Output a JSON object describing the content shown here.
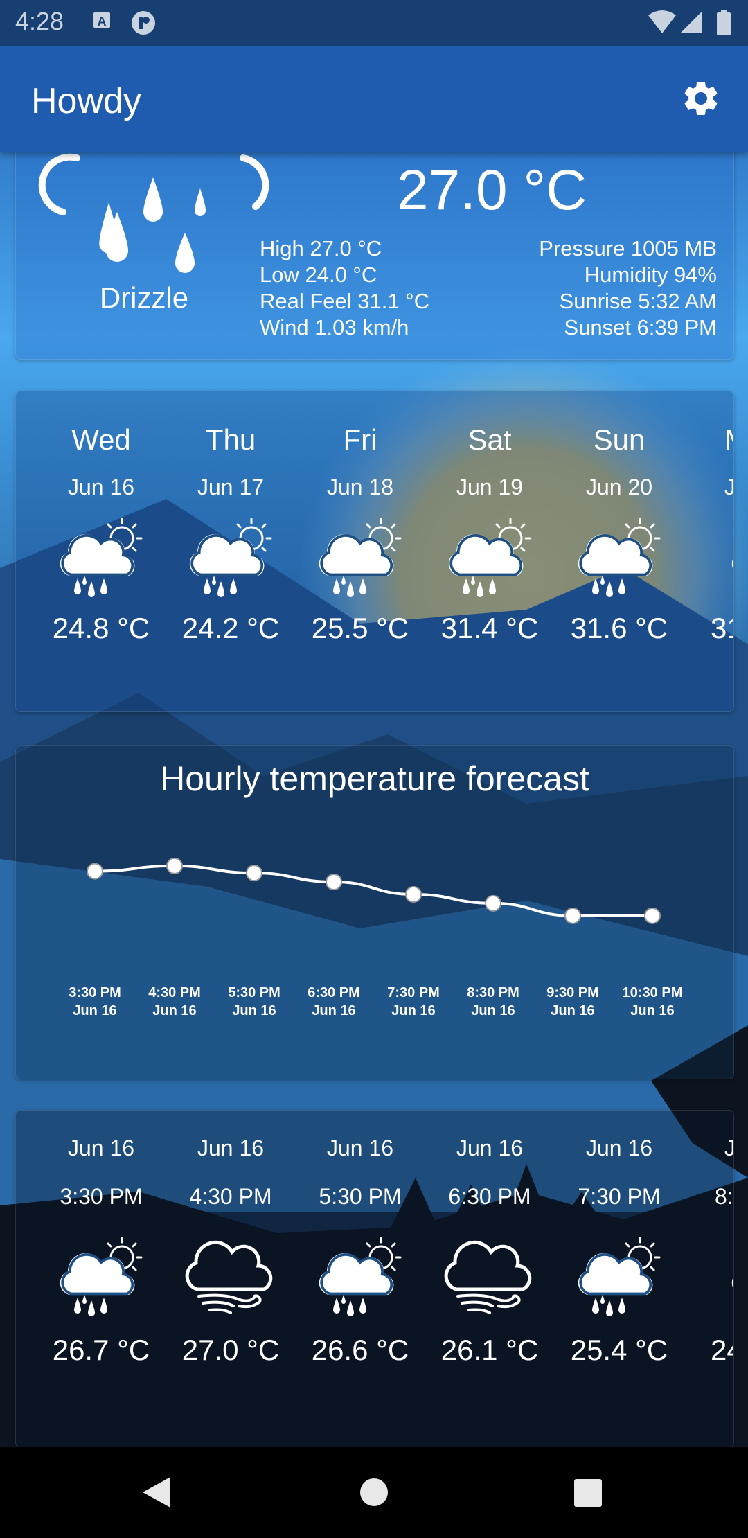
{
  "status_bar": {
    "time": "4:28"
  },
  "app_bar": {
    "title": "Howdy",
    "settings_icon": "gear-icon"
  },
  "current": {
    "condition": "Drizzle",
    "icon": "drizzle-icon",
    "temperature": "27.0 °C",
    "high": "High 27.0 °C",
    "low": "Low 24.0 °C",
    "real_feel": "Real Feel 31.1 °C",
    "wind": "Wind 1.03 km/h",
    "pressure": "Pressure 1005 MB",
    "humidity": "Humidity 94%",
    "sunrise": "Sunrise 5:32 AM",
    "sunset": "Sunset 6:39 PM"
  },
  "daily": [
    {
      "day": "Wed",
      "date": "Jun 16",
      "icon": "sun-rain-icon",
      "temp": "24.8 °C"
    },
    {
      "day": "Thu",
      "date": "Jun 17",
      "icon": "sun-rain-icon",
      "temp": "24.2 °C"
    },
    {
      "day": "Fri",
      "date": "Jun 18",
      "icon": "sun-rain-icon",
      "temp": "25.5 °C"
    },
    {
      "day": "Sat",
      "date": "Jun 19",
      "icon": "sun-rain-icon",
      "temp": "31.4 °C"
    },
    {
      "day": "Sun",
      "date": "Jun 20",
      "icon": "sun-rain-icon",
      "temp": "31.6 °C"
    },
    {
      "day": "M",
      "date": "J",
      "icon": "sun-rain-icon",
      "temp": "31"
    }
  ],
  "hourly_chart": {
    "title": "Hourly temperature forecast",
    "chart_data": {
      "type": "line",
      "title": "Hourly temperature forecast",
      "x": [
        "3:30 PM",
        "4:30 PM",
        "5:30 PM",
        "6:30 PM",
        "7:30 PM",
        "8:30 PM",
        "9:30 PM",
        "10:30 PM"
      ],
      "x_sub": [
        "Jun 16",
        "Jun 16",
        "Jun 16",
        "Jun 16",
        "Jun 16",
        "Jun 16",
        "Jun 16",
        "Jun 16"
      ],
      "series": [
        {
          "values": [
            26.7,
            27.0,
            26.6,
            26.1,
            25.4,
            24.9,
            24.2,
            24.2
          ]
        }
      ],
      "ylim": [
        24,
        27.5
      ],
      "grid": false
    }
  },
  "hourly": [
    {
      "date": "Jun 16",
      "time": "3:30 PM",
      "icon": "sun-rain-icon",
      "temp": "26.7 °C"
    },
    {
      "date": "Jun 16",
      "time": "4:30 PM",
      "icon": "windy-cloud-icon",
      "temp": "27.0 °C"
    },
    {
      "date": "Jun 16",
      "time": "5:30 PM",
      "icon": "sun-rain-icon",
      "temp": "26.6 °C"
    },
    {
      "date": "Jun 16",
      "time": "6:30 PM",
      "icon": "windy-cloud-icon",
      "temp": "26.1 °C"
    },
    {
      "date": "Jun 16",
      "time": "7:30 PM",
      "icon": "sun-rain-icon",
      "temp": "25.4 °C"
    },
    {
      "date": "J",
      "time": "8:",
      "icon": "sun-rain-icon",
      "temp": "24"
    }
  ],
  "nav": {
    "back": "back-icon",
    "home": "home-icon",
    "recents": "recents-icon"
  }
}
